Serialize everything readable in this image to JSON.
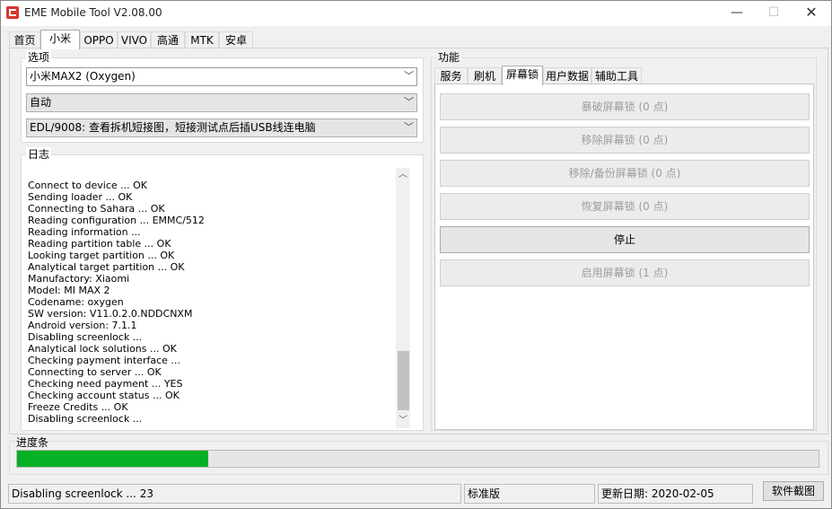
{
  "window": {
    "title": "EME Mobile Tool V2.08.00",
    "min_glyph": "—",
    "max_glyph": "☐",
    "close_glyph": "✕"
  },
  "top_tabs": [
    "首页",
    "小米",
    "OPPO",
    "VIVO",
    "高通",
    "MTK",
    "安卓"
  ],
  "options": {
    "title": "选项",
    "model": "小米MAX2 (Oxygen)",
    "mode": "自动",
    "method": "EDL/9008: 查看拆机短接图，短接测试点后插USB线连电脑"
  },
  "log": {
    "title": "日志",
    "lines": [
      "Connect to device ... OK",
      "Sending loader ... OK",
      "Connecting to Sahara ... OK",
      "Reading configuration ... EMMC/512",
      "Reading information ...",
      "Reading partition table ... OK",
      "Looking target partition ... OK",
      "Analytical target partition ... OK",
      "Manufactory: Xiaomi",
      "Model: MI MAX 2",
      "Codename: oxygen",
      "SW version: V11.0.2.0.NDDCNXM",
      "Android version: 7.1.1",
      "Disabling screenlock ...",
      "Analytical lock solutions ... OK",
      "Checking payment interface ...",
      "Connecting to server ... OK",
      "Checking need payment ... YES",
      "Checking account status ... OK",
      "Freeze Credits ... OK",
      "Disabling screenlock ..."
    ]
  },
  "functions": {
    "title": "功能",
    "tabs": [
      "服务",
      "刷机",
      "屏幕锁",
      "用户数据",
      "辅助工具"
    ],
    "buttons": [
      {
        "label": "暴破屏幕锁 (0 点)",
        "enabled": false
      },
      {
        "label": "移除屏幕锁 (0 点)",
        "enabled": false
      },
      {
        "label": "移除/备份屏幕锁 (0 点)",
        "enabled": false
      },
      {
        "label": "恢复屏幕锁 (0 点)",
        "enabled": false
      },
      {
        "label": "停止",
        "enabled": true
      },
      {
        "label": "启用屏幕锁 (1 点)",
        "enabled": false
      }
    ]
  },
  "progress": {
    "title": "进度条",
    "fraction": 0.239,
    "color": "#06b025"
  },
  "status": {
    "message": "Disabling screenlock ... 23",
    "edition": "标准版",
    "update_date": "更新日期:  2020-02-05",
    "screenshot_button": "软件截图"
  }
}
